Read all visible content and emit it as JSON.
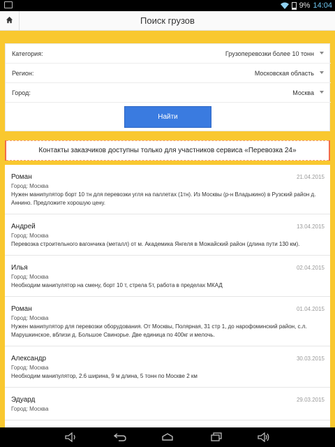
{
  "status_bar": {
    "battery_pct": "9%",
    "time": "14:04",
    "icons": [
      "sim-icon",
      "wifi-icon",
      "battery-icon"
    ]
  },
  "header": {
    "title": "Поиск грузов",
    "home_icon": "home-icon"
  },
  "filters": {
    "category": {
      "label": "Категория:",
      "value": "Грузоперевозки более 10 тонн"
    },
    "region": {
      "label": "Регион:",
      "value": "Московская область"
    },
    "city": {
      "label": "Город:",
      "value": "Москва"
    },
    "search_label": "Найти"
  },
  "notice": "Контакты заказчиков доступны только для участников сервиса «Перевозка 24»",
  "list": [
    {
      "name": "Роман",
      "date": "21.04.2015",
      "city": "Город: Москва",
      "desc_lines": [
        "Нужен манипулятор борт 10 тн для перевозки угля на паллетах (1тн). Из Москвы (р-н Владыкино) в Рузский район д.",
        "Аннино. Предложите хорошую цену."
      ]
    },
    {
      "name": "Андрей",
      "date": "13.04.2015",
      "city": "Город: Москва",
      "desc_lines": [
        "Перевозка строительного вагончика (металл) от м. Академика Янгеля в Можайский район (длина пути 130 км)."
      ]
    },
    {
      "name": "Илья",
      "date": "02.04.2015",
      "city": "Город: Москва",
      "desc_lines": [
        "Необходим манипулятор на смену, борт 10 т, стрела 5т, работа в пределах МКАД"
      ]
    },
    {
      "name": "Роман",
      "date": "01.04.2015",
      "city": "Город: Москва",
      "desc_lines": [
        "Нужен манипулятор для перевозки оборудования. От Москвы, Полярная, 31 стр 1, до нарофоминский район, с.л.",
        "Марушкинское, вблизи д. Большое Свинорье. Две единица по 400кг и мелочь."
      ]
    },
    {
      "name": "Александр",
      "date": "30.03.2015",
      "city": "Город: Москва",
      "desc_lines": [
        "Необходим манипулятор, 2.6 ширина, 9 м длина, 5 тонн по Москве 2 км"
      ]
    },
    {
      "name": "Эдуард",
      "date": "29.03.2015",
      "city": "Город: Москва",
      "desc_lines": []
    }
  ],
  "nav_bar": {
    "icons": [
      "volume-down-icon",
      "back-icon",
      "home-icon",
      "recents-icon",
      "volume-up-icon"
    ]
  },
  "colors": {
    "accent": "#f9c82f",
    "button": "#3a7be0",
    "notice_border": "#f26b4a"
  }
}
